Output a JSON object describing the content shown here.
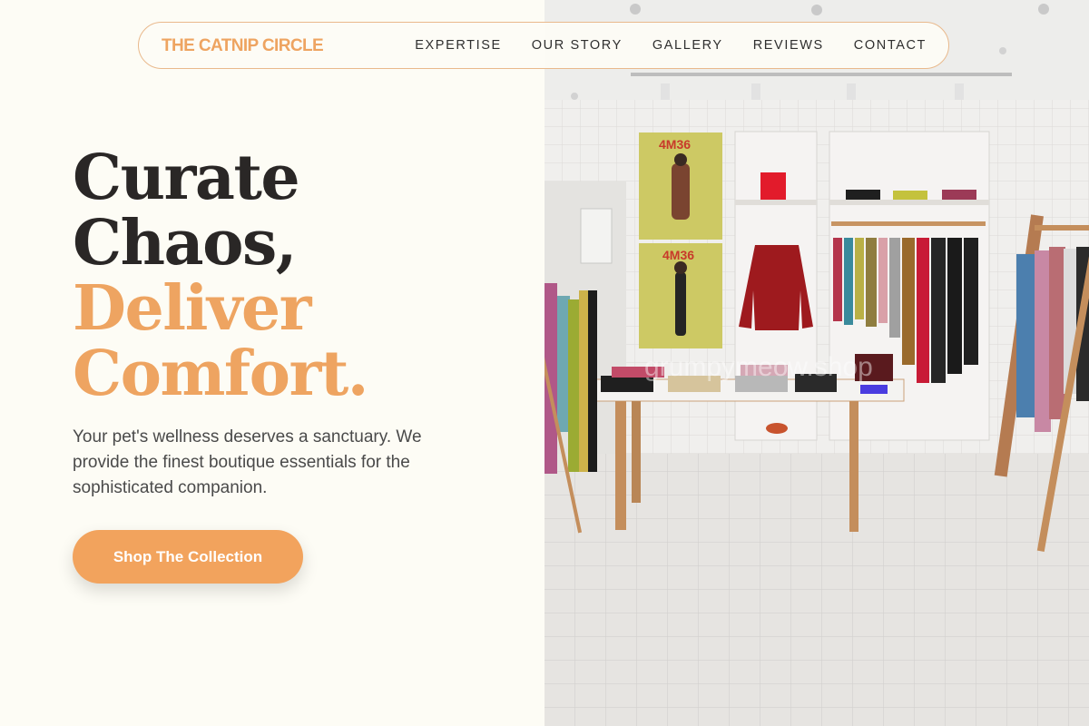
{
  "nav": {
    "brand": "THE CATNIP CIRCLE",
    "links": [
      "EXPERTISE",
      "OUR STORY",
      "GALLERY",
      "REVIEWS",
      "CONTACT"
    ]
  },
  "hero": {
    "line1": "Curate",
    "line2": "Chaos,",
    "line3": "Deliver",
    "line4": "Comfort.",
    "subtitle": "Your pet's wellness deserves a sanctuary. We provide the finest boutique essentials for the sophisticated companion.",
    "cta": "Shop The Collection"
  },
  "store_image": {
    "poster_text": "4M36",
    "watermark": "grumpymeow.shop"
  },
  "colors": {
    "accent": "#eea461",
    "button": "#f2a35d",
    "background": "#fdfcf5",
    "text": "#2a2726"
  }
}
